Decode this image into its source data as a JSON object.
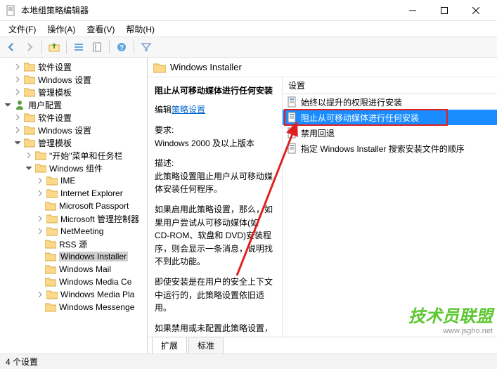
{
  "window": {
    "title": "本地组策略编辑器"
  },
  "menubar": {
    "file": "文件(F)",
    "action": "操作(A)",
    "view": "查看(V)",
    "help": "帮助(H)"
  },
  "tree": {
    "n0": "软件设置",
    "n1": "Windows 设置",
    "n2": "管理模板",
    "n3": "用户配置",
    "n4": "软件设置",
    "n5": "Windows 设置",
    "n6": "管理模板",
    "n7": "\"开始\"菜单和任务栏",
    "n8": "Windows 组件",
    "n9": "IME",
    "n10": "Internet Explorer",
    "n11": "Microsoft Passport",
    "n12": "Microsoft 管理控制器",
    "n13": "NetMeeting",
    "n14": "RSS 源",
    "n15": "Windows Installer",
    "n16": "Windows Mail",
    "n17": "Windows Media Ce",
    "n18": "Windows Media Pla",
    "n19": "Windows Messenge"
  },
  "detail": {
    "crumb": "Windows Installer",
    "heading": "阻止从可移动媒体进行任何安装",
    "edit_label": "编辑",
    "edit_link": "策略设置",
    "req_label": "要求:",
    "req_text": "Windows 2000 及以上版本",
    "desc_label": "描述:",
    "desc_p1": "此策略设置阻止用户从可移动媒体安装任何程序。",
    "desc_p2": "如果启用此策略设置，那么，如果用户尝试从可移动媒体(如 CD-ROM、软盘和 DVD)安装程序，则会显示一条消息，说明找不到此功能。",
    "desc_p3": "即使安装是在用户的安全上下文中运行的，此策略设置依旧适用。",
    "desc_p4": "如果禁用或未配置此策略设置，那"
  },
  "settings": {
    "col_header": "设置",
    "items": {
      "s0": "始终以提升的权限进行安装",
      "s1": "阻止从可移动媒体进行任何安装",
      "s2": "禁用回退",
      "s3": "指定 Windows Installer 搜索安装文件的顺序"
    }
  },
  "tabs": {
    "extended": "扩展",
    "standard": "标准"
  },
  "status": {
    "text": "4 个设置"
  },
  "watermark": {
    "text": "技术员联盟",
    "url": "www.jsgho.net"
  }
}
